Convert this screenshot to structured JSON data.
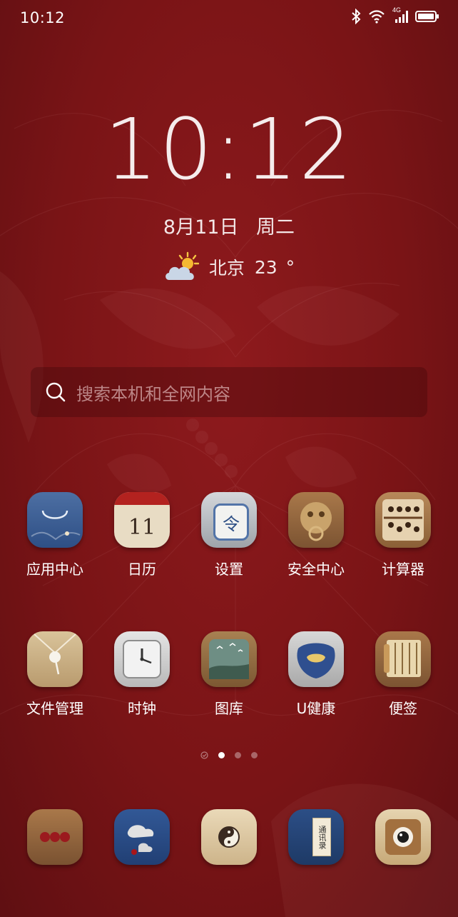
{
  "status_bar": {
    "time": "10:12",
    "network": "4G",
    "icons": [
      "bluetooth-icon",
      "wifi-icon",
      "signal-icon",
      "battery-icon"
    ]
  },
  "lockclock": {
    "time": "10:12",
    "date": "8月11日",
    "weekday": "周二"
  },
  "weather": {
    "city": "北京",
    "temperature": "23",
    "unit": "°",
    "icon": "partly-cloudy-icon"
  },
  "search": {
    "placeholder": "搜索本机和全网内容"
  },
  "apps_row1": [
    {
      "label": "应用中心",
      "icon": "app-center-icon"
    },
    {
      "label": "日历",
      "icon": "calendar-icon",
      "day": "11"
    },
    {
      "label": "设置",
      "icon": "settings-icon",
      "glyph": "令"
    },
    {
      "label": "安全中心",
      "icon": "security-center-icon"
    },
    {
      "label": "计算器",
      "icon": "calculator-icon"
    }
  ],
  "apps_row2": [
    {
      "label": "文件管理",
      "icon": "file-manager-icon"
    },
    {
      "label": "时钟",
      "icon": "clock-icon"
    },
    {
      "label": "图库",
      "icon": "gallery-icon"
    },
    {
      "label": "U健康",
      "icon": "health-icon"
    },
    {
      "label": "便签",
      "icon": "notes-icon"
    }
  ],
  "dock": [
    {
      "icon": "phone-icon"
    },
    {
      "icon": "messages-icon"
    },
    {
      "icon": "browser-icon"
    },
    {
      "icon": "contacts-icon",
      "glyph": "通讯录"
    },
    {
      "icon": "camera-icon"
    }
  ],
  "pages": {
    "count": 4,
    "current": 2
  },
  "colors": {
    "background": "#7a1416",
    "accent": "#f5ecec"
  }
}
